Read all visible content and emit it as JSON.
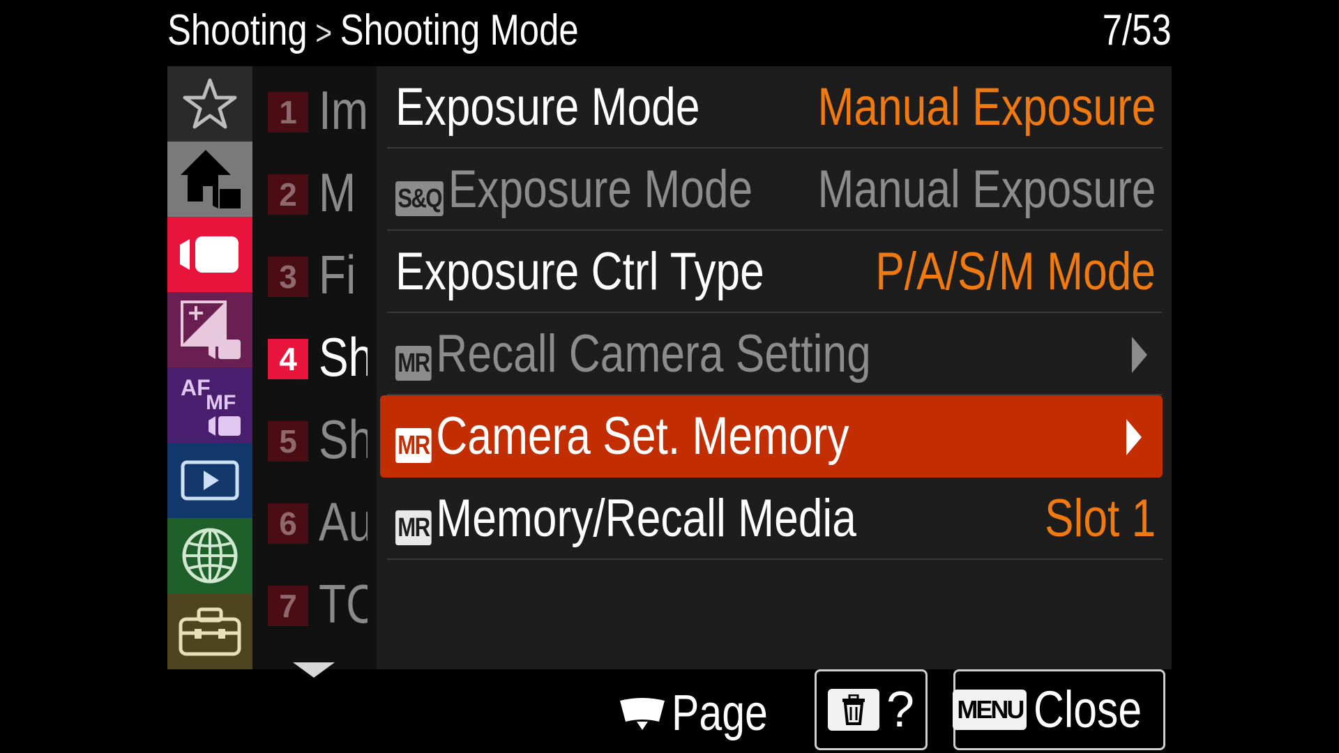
{
  "header": {
    "crumb_parent": "Shooting",
    "crumb_separator": ">",
    "crumb_current": "Shooting Mode",
    "page_indicator": "7/53"
  },
  "categories": [
    {
      "name": "my-menu",
      "icon": "star-icon",
      "color": "#2a2a2a"
    },
    {
      "name": "main",
      "icon": "home-camera-icon",
      "color": "#7a7a7a"
    },
    {
      "name": "shooting",
      "icon": "video-camera-icon",
      "color": "#e8143c"
    },
    {
      "name": "exposure-color",
      "icon": "exposure-comp-icon",
      "color": "#6a1f52"
    },
    {
      "name": "focus",
      "icon": "af-mf-icon",
      "color": "#4a1e6e",
      "label_af": "AF",
      "label_mf": "MF"
    },
    {
      "name": "playback",
      "icon": "play-icon",
      "color": "#12386c"
    },
    {
      "name": "network",
      "icon": "globe-icon",
      "color": "#1f5f2a"
    },
    {
      "name": "setup",
      "icon": "toolbox-icon",
      "color": "#4f4420"
    }
  ],
  "groups": [
    {
      "number": "1",
      "fragment": "Im",
      "active": false
    },
    {
      "number": "2",
      "fragment": "M",
      "active": false
    },
    {
      "number": "3",
      "fragment": "Fi",
      "active": false
    },
    {
      "number": "4",
      "fragment": "Sh",
      "active": true
    },
    {
      "number": "5",
      "fragment": "Sh",
      "active": false
    },
    {
      "number": "6",
      "fragment": "Au",
      "active": false
    },
    {
      "number": "7",
      "fragment": "TC",
      "active": false
    }
  ],
  "items": [
    {
      "badge": "",
      "label": "Exposure Mode",
      "value": "Manual Exposure",
      "enabled": true,
      "arrow": false
    },
    {
      "badge": "S&Q",
      "label": "Exposure Mode",
      "value": "Manual Exposure",
      "enabled": false,
      "arrow": false
    },
    {
      "badge": "",
      "label": "Exposure Ctrl Type",
      "value": "P/A/S/M Mode",
      "enabled": true,
      "arrow": false
    },
    {
      "badge": "MR",
      "label": "Recall Camera Setting",
      "value": "",
      "enabled": false,
      "arrow": true
    },
    {
      "badge": "MR",
      "label": "Camera Set. Memory",
      "value": "",
      "enabled": true,
      "arrow": true,
      "selected": true
    },
    {
      "badge": "MR",
      "label": "Memory/Recall Media",
      "value": "Slot 1",
      "enabled": true,
      "arrow": false
    }
  ],
  "footer": {
    "page_label": "Page",
    "help_label": "?",
    "menu_key": "MENU",
    "close_label": "Close"
  },
  "colors": {
    "accent_orange": "#f07a10",
    "selected_row": "#c22d02",
    "active_group": "#e8143c"
  }
}
